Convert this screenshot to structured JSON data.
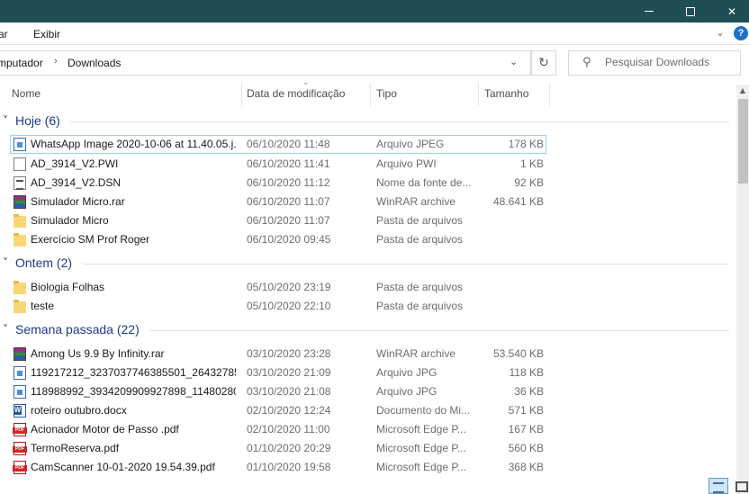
{
  "ribbon": {
    "tabs": [
      "ar",
      "Exibir"
    ],
    "help_label": "?"
  },
  "address": {
    "segments": [
      "mputador",
      "Downloads"
    ],
    "separator": "›"
  },
  "search": {
    "placeholder": "Pesquisar Downloads"
  },
  "columns": {
    "name": "Nome",
    "date": "Data de modificação",
    "type": "Tipo",
    "size": "Tamanho"
  },
  "groups": [
    {
      "label": "Hoje (6)",
      "items": [
        {
          "icon": "image-file-icon",
          "name": "WhatsApp Image 2020-10-06 at 11.40.05.j...",
          "date": "06/10/2020 11:48",
          "type": "Arquivo JPEG",
          "size": "178 KB"
        },
        {
          "icon": "generic-file-icon",
          "name": "AD_3914_V2.PWI",
          "date": "06/10/2020 11:41",
          "type": "Arquivo PWI",
          "size": "1 KB"
        },
        {
          "icon": "dsn-file-icon",
          "name": "AD_3914_V2.DSN",
          "date": "06/10/2020 11:12",
          "type": "Nome da fonte de...",
          "size": "92 KB"
        },
        {
          "icon": "winrar-archive-icon",
          "name": "Simulador Micro.rar",
          "date": "06/10/2020 11:07",
          "type": "WinRAR archive",
          "size": "48.641 KB"
        },
        {
          "icon": "folder-icon",
          "name": "Simulador Micro",
          "date": "06/10/2020 11:07",
          "type": "Pasta de arquivos",
          "size": ""
        },
        {
          "icon": "folder-icon",
          "name": "Exercício SM Prof Roger",
          "date": "06/10/2020 09:45",
          "type": "Pasta de arquivos",
          "size": ""
        }
      ]
    },
    {
      "label": "Ontem (2)",
      "items": [
        {
          "icon": "folder-icon",
          "name": "Biologia Folhas",
          "date": "05/10/2020 23:19",
          "type": "Pasta de arquivos",
          "size": ""
        },
        {
          "icon": "folder-icon",
          "name": "teste",
          "date": "05/10/2020 22:10",
          "type": "Pasta de arquivos",
          "size": ""
        }
      ]
    },
    {
      "label": "Semana passada (22)",
      "items": [
        {
          "icon": "winrar-archive-icon",
          "name": "Among Us 9.9 By Infinity.rar",
          "date": "03/10/2020 23:28",
          "type": "WinRAR archive",
          "size": "53.540 KB"
        },
        {
          "icon": "image-file-icon",
          "name": "119217212_3237037746385501_264327851...",
          "date": "03/10/2020 21:09",
          "type": "Arquivo JPG",
          "size": "118 KB"
        },
        {
          "icon": "image-file-icon",
          "name": "118988992_3934209909927898_114802809...",
          "date": "03/10/2020 21:08",
          "type": "Arquivo JPG",
          "size": "36 KB"
        },
        {
          "icon": "word-document-icon",
          "name": "roteiro outubro.docx",
          "date": "02/10/2020 12:24",
          "type": "Documento do Mi...",
          "size": "571 KB"
        },
        {
          "icon": "pdf-file-icon",
          "name": "Acionador Motor de Passo .pdf",
          "date": "02/10/2020 11:00",
          "type": "Microsoft Edge P...",
          "size": "167 KB"
        },
        {
          "icon": "pdf-file-icon",
          "name": "TermoReserva.pdf",
          "date": "01/10/2020 20:29",
          "type": "Microsoft Edge P...",
          "size": "560 KB"
        },
        {
          "icon": "pdf-file-icon",
          "name": "CamScanner 10-01-2020 19.54.39.pdf",
          "date": "01/10/2020 19:58",
          "type": "Microsoft Edge P...",
          "size": "368 KB"
        }
      ]
    }
  ],
  "selected_item": "WhatsApp Image 2020-10-06 at 11.40.05.j...",
  "colors": {
    "titlebar": "#1f4e55",
    "group_label": "#1e3a8a",
    "selection_border": "#99d1ff"
  }
}
